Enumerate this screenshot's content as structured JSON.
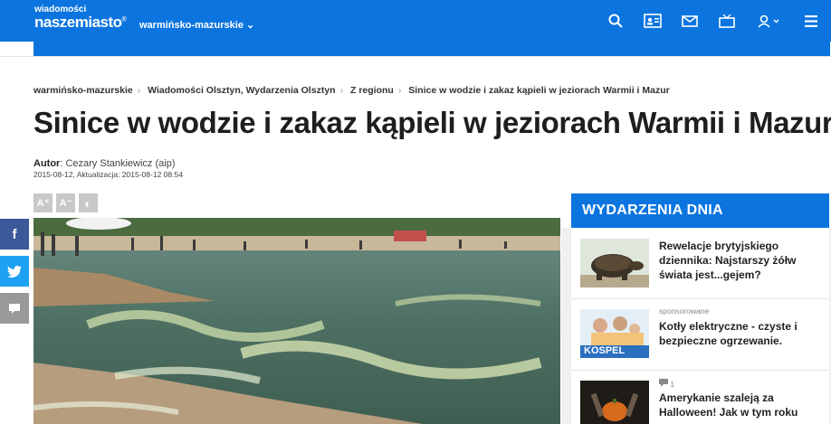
{
  "header": {
    "logo_top": "wiadomości",
    "logo_main": "naszemiasto",
    "logo_mark": "®",
    "region": "warmińsko-mazurskie",
    "region_chevron": "⌄",
    "icons": [
      "search-icon",
      "id-card-icon",
      "mail-icon",
      "tv-icon",
      "user-icon",
      "menu-icon"
    ]
  },
  "breadcrumb": {
    "items": [
      "warmińsko-mazurskie",
      "Wiadomości Olsztyn, Wydarzenia Olsztyn",
      "Z regionu",
      "Sinice w wodzie i zakaz kąpieli w jeziorach Warmii i Mazur"
    ],
    "separator": "›"
  },
  "article": {
    "title": "Sinice w wodzie i zakaz kąpieli w jeziorach Warmii i Mazur",
    "author_label": "Autor",
    "author_name": "Cezary Stankiewicz (aip)",
    "dates": "2015-08-12, Aktualizacja: 2015-08-12 08:54",
    "tools": [
      "A⁺",
      "A⁻",
      "◐"
    ]
  },
  "share": {
    "facebook": "f",
    "twitter": "t",
    "comment": "▪"
  },
  "sidebar": {
    "heading": "WYDARZENIA DNIA",
    "items": [
      {
        "meta": "",
        "title": "Rewelacje brytyjskiego dziennika: Najstarszy żółw świata jest...gejem?"
      },
      {
        "meta": "sponsorowane",
        "title": "Kotły elektryczne - czyste i bezpieczne ogrzewanie."
      },
      {
        "meta": "1",
        "title": "Amerykanie szaleją za Halloween! Jak w tym roku"
      }
    ],
    "kospel_label": "KOSPEL"
  },
  "colors": {
    "brand": "#0b74de",
    "facebook": "#3b5998",
    "twitter": "#1da1f2",
    "comment": "#999999"
  }
}
